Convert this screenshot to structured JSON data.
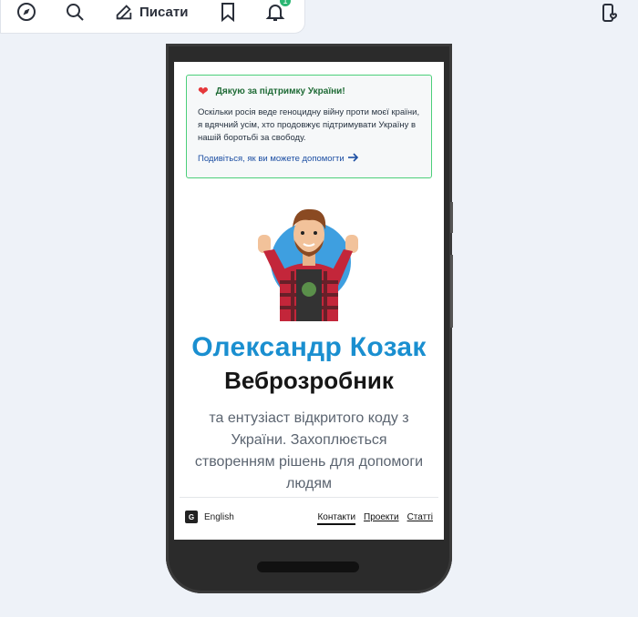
{
  "toolbar": {
    "write_label": "Писати",
    "notifications_count": "1",
    "icons": [
      "compass-icon",
      "search-icon",
      "pencil-icon",
      "bookmark-icon",
      "bell-icon",
      "phone-heart-icon"
    ]
  },
  "support": {
    "title": "Дякую за підтримку України!",
    "text": "Оскільки росія веде геноцидну війну проти моєї країни, я вдячний усім, хто продовжує підтримувати Україну в нашій боротьбі за свободу.",
    "link": "Подивіться, як ви можете допомогти"
  },
  "hero": {
    "name": "Олександр Козак",
    "role": "Веброзробник",
    "description": "та ентузіаст відкритого коду з України. Захоплюється створенням рішень для допомоги людям"
  },
  "footer": {
    "language": "English",
    "nav": [
      "Контакти",
      "Проекти",
      "Статті"
    ]
  },
  "colors": {
    "accent": "#1a8fd0",
    "support_border": "#4ccf7a",
    "page_bg": "#eef2f8"
  }
}
